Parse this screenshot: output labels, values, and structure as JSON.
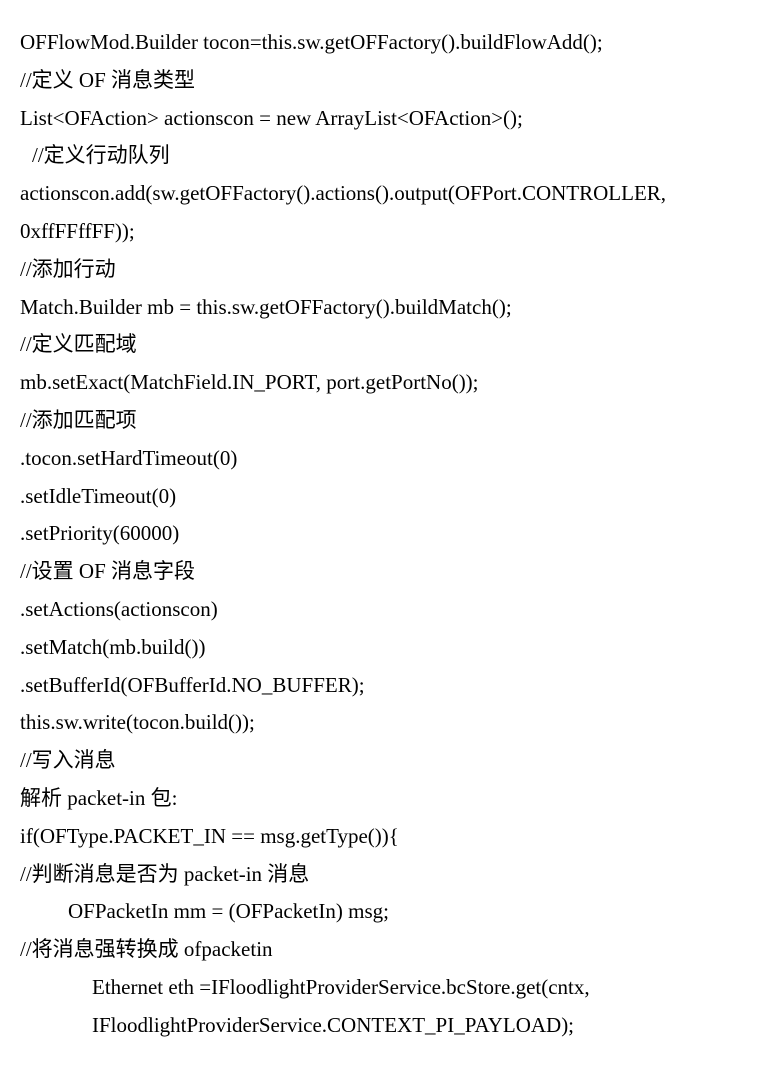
{
  "lines": [
    {
      "text": "OFFlowMod.Builder tocon=this.sw.getOFFactory().buildFlowAdd();",
      "cls": ""
    },
    {
      "text": "//定义 OF 消息类型",
      "cls": ""
    },
    {
      "text": "List<OFAction> actionscon = new ArrayList<OFAction>();",
      "cls": ""
    },
    {
      "text": "//定义行动队列",
      "cls": "indent1"
    },
    {
      "text": "actionscon.add(sw.getOFFactory().actions().output(OFPort.CONTROLLER,",
      "cls": ""
    },
    {
      "text": "0xffFFffFF));",
      "cls": ""
    },
    {
      "text": "//添加行动",
      "cls": ""
    },
    {
      "text": "Match.Builder mb = this.sw.getOFFactory().buildMatch();",
      "cls": ""
    },
    {
      "text": "//定义匹配域",
      "cls": ""
    },
    {
      "text": "mb.setExact(MatchField.IN_PORT, port.getPortNo());",
      "cls": ""
    },
    {
      "text": "//添加匹配项",
      "cls": ""
    },
    {
      "text": ".tocon.setHardTimeout(0)",
      "cls": ""
    },
    {
      "text": ".setIdleTimeout(0)",
      "cls": ""
    },
    {
      "text": ".setPriority(60000)",
      "cls": ""
    },
    {
      "text": "//设置 OF 消息字段",
      "cls": ""
    },
    {
      "text": ".setActions(actionscon)",
      "cls": ""
    },
    {
      "text": ".setMatch(mb.build())",
      "cls": ""
    },
    {
      "text": ".setBufferId(OFBufferId.NO_BUFFER);",
      "cls": ""
    },
    {
      "text": "this.sw.write(tocon.build());",
      "cls": ""
    },
    {
      "text": "//写入消息",
      "cls": ""
    },
    {
      "text": "解析 packet-in 包:",
      "cls": ""
    },
    {
      "text": "if(OFType.PACKET_IN == msg.getType()){",
      "cls": ""
    },
    {
      "text": "//判断消息是否为 packet-in 消息",
      "cls": ""
    },
    {
      "text": "OFPacketIn mm = (OFPacketIn) msg;",
      "cls": "indent2"
    },
    {
      "text": "//将消息强转换成 ofpacketin",
      "cls": ""
    },
    {
      "text": "Ethernet eth =IFloodlightProviderService.bcStore.get(cntx,",
      "cls": "indent3"
    },
    {
      "text": "IFloodlightProviderService.CONTEXT_PI_PAYLOAD);",
      "cls": "indent3"
    }
  ]
}
